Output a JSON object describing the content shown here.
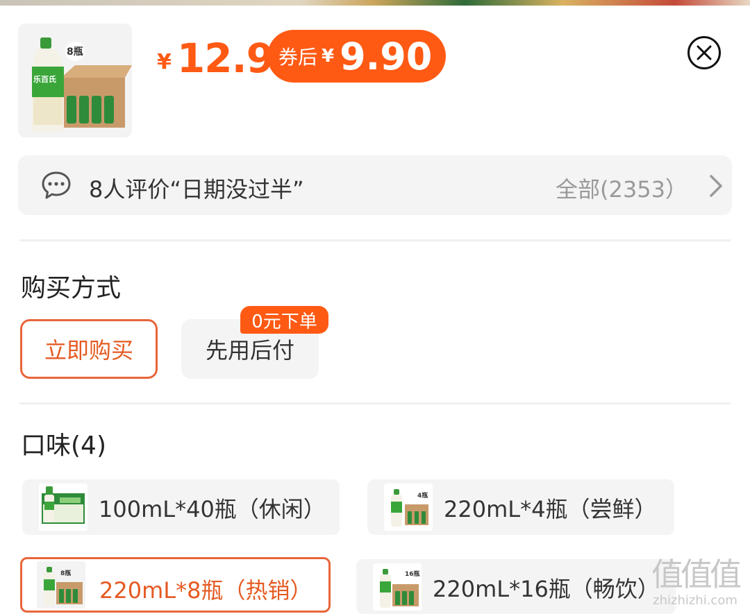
{
  "product": {
    "price_symbol": "¥",
    "price": "12.9",
    "coupon_label": "券后",
    "coupon_symbol": "¥",
    "coupon_price": "9.90",
    "thumb_badge": "8瓶",
    "thumb_brand": "乐百氏"
  },
  "review": {
    "summary": "8人评价“日期没过半”",
    "all_label": "全部(2353）"
  },
  "purchase": {
    "title": "购买方式",
    "options": [
      {
        "label": "立即购买",
        "selected": true
      },
      {
        "label": "先用后付",
        "selected": false,
        "badge": "0元下单"
      }
    ]
  },
  "flavor": {
    "title": "口味(4)",
    "options": [
      {
        "label": "100mL*40瓶（休闲）",
        "selected": false,
        "thumb_badge": ""
      },
      {
        "label": "220mL*4瓶（尝鲜）",
        "selected": false,
        "thumb_badge": "4瓶"
      },
      {
        "label": "220mL*8瓶（热销）",
        "selected": true,
        "thumb_badge": "8瓶"
      },
      {
        "label": "220mL*16瓶（畅饮）",
        "selected": false,
        "thumb_badge": "16瓶"
      }
    ]
  },
  "watermark": {
    "big": "值值值",
    "small": "zhizhizhi.com"
  },
  "colors": {
    "accent": "#ff5a14",
    "selected_border": "#e8653a",
    "bg_light": "#f4f4f4"
  }
}
